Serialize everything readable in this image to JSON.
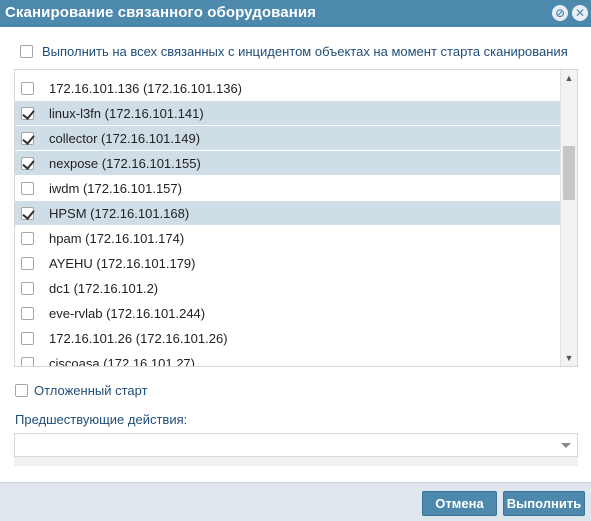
{
  "dialog": {
    "title": "Сканирование связанного оборудования"
  },
  "scan_all": {
    "label": "Выполнить на всех связанных с инцидентом объектах на момент старта сканирования",
    "checked": false
  },
  "devices": [
    {
      "label": "172.16.101.136 (172.16.101.136)",
      "checked": false,
      "selected": false
    },
    {
      "label": "linux-l3fn (172.16.101.141)",
      "checked": true,
      "selected": true
    },
    {
      "label": "collector (172.16.101.149)",
      "checked": true,
      "selected": true
    },
    {
      "label": "nexpose (172.16.101.155)",
      "checked": true,
      "selected": true
    },
    {
      "label": "iwdm (172.16.101.157)",
      "checked": false,
      "selected": false
    },
    {
      "label": "HPSM (172.16.101.168)",
      "checked": true,
      "selected": true
    },
    {
      "label": "hpam (172.16.101.174)",
      "checked": false,
      "selected": false
    },
    {
      "label": "AYEHU (172.16.101.179)",
      "checked": false,
      "selected": false
    },
    {
      "label": "dc1 (172.16.101.2)",
      "checked": false,
      "selected": false
    },
    {
      "label": "eve-rvlab (172.16.101.244)",
      "checked": false,
      "selected": false
    },
    {
      "label": "172.16.101.26 (172.16.101.26)",
      "checked": false,
      "selected": false
    },
    {
      "label": "ciscoasa (172.16.101.27)",
      "checked": false,
      "selected": false
    }
  ],
  "delayed_start": {
    "label": "Отложенный старт",
    "checked": false
  },
  "previous_actions": {
    "label": "Предшествующие действия:",
    "value": ""
  },
  "footer": {
    "cancel_label": "Отмена",
    "run_label": "Выполнить"
  },
  "icons": {
    "restore": "restore-icon",
    "close": "close-icon"
  },
  "colors": {
    "accent": "#4d88ad",
    "selection": "#cfdde6",
    "label_text": "#1f4e79"
  }
}
